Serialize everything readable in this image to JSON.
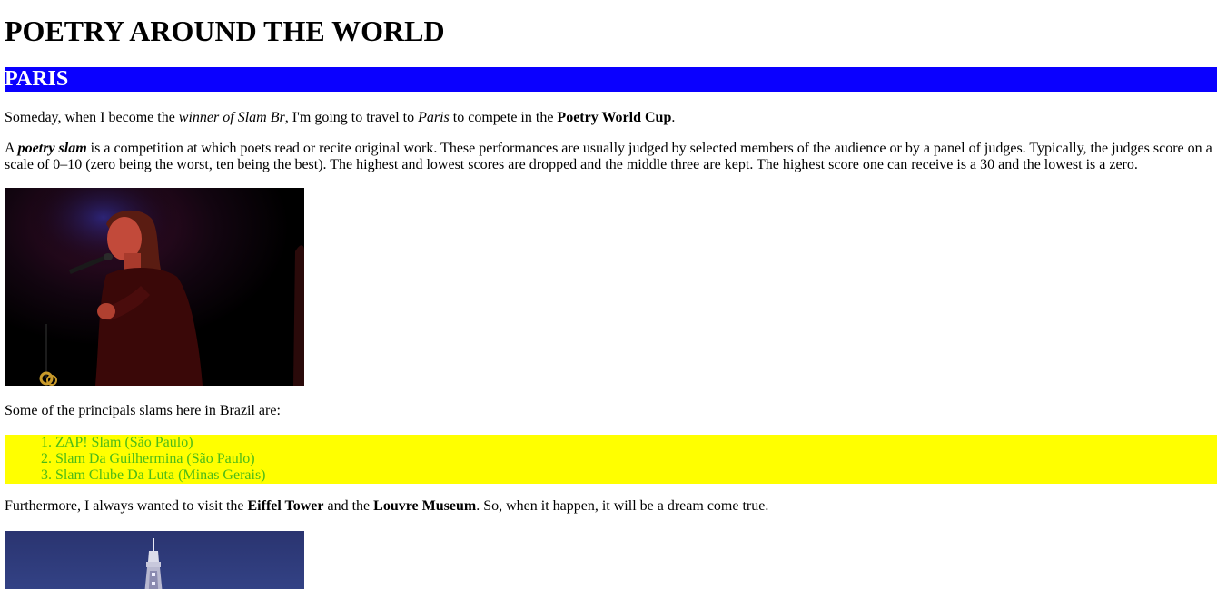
{
  "header": {
    "title": "POETRY AROUND THE WORLD"
  },
  "section": {
    "city": "PARIS",
    "banner_color": "#0a00ff"
  },
  "intro": {
    "t1": "Someday, when I become the ",
    "em1": "winner of Slam Br",
    "t2": ", I'm going to travel to ",
    "em2": "Paris",
    "t3": " to compete in the ",
    "strong1": "Poetry World Cup",
    "t4": "."
  },
  "definition": {
    "t1": "A ",
    "term": "poetry slam",
    "t2": " is a competition at which poets read or recite original work. These performances are usually judged by selected members of the audience or by a panel of judges. Typically, the judges score on a scale of 0–10 (zero being the worst, ten being the best). The highest and lowest scores are dropped and the middle three are kept. The highest score one can receive is a 30 and the lowest is a zero."
  },
  "images": {
    "performer_photo": "poet performing at microphone on dark stage",
    "tower_photo": "Eiffel Tower at night"
  },
  "slams": {
    "intro": "Some of the principals slams here in Brazil are:",
    "list_bg": "#ffff00",
    "list_color": "#4cbb17",
    "items": [
      {
        "num": "1.",
        "label": "ZAP! Slam (São Paulo)"
      },
      {
        "num": "2.",
        "label": "Slam Da Guilhermina (São Paulo)"
      },
      {
        "num": "3.",
        "label": "Slam Clube Da Luta (Minas Gerais)"
      }
    ]
  },
  "outro": {
    "t1": "Furthermore, I always wanted to visit the ",
    "strong1": "Eiffel Tower",
    "t2": " and the ",
    "strong2": "Louvre Museum",
    "t3": ". So, when it happen, it will be a dream come true."
  }
}
